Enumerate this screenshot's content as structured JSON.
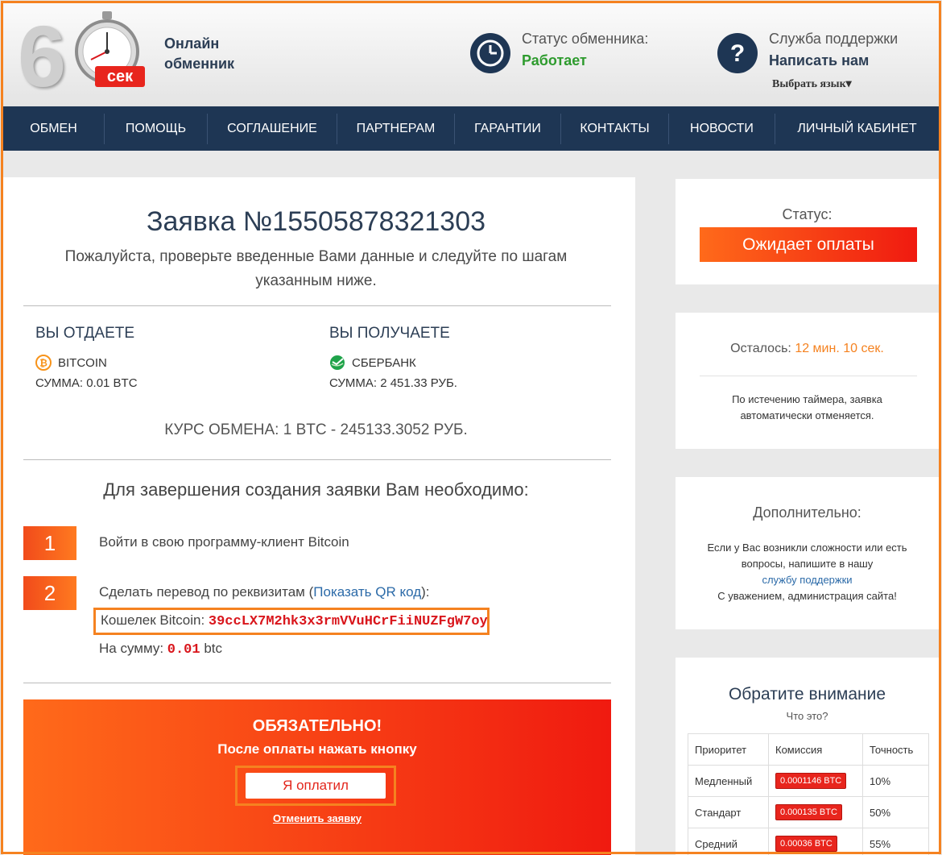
{
  "header": {
    "logo_number": "6",
    "logo_badge": "сек",
    "brand_line1": "Онлайн",
    "brand_line2": "обменник",
    "status_label": "Статус обменника:",
    "status_value": "Работает",
    "support_label": "Служба поддержки",
    "support_link": "Написать нам",
    "language_select": "Выбрать язык▾",
    "colors": {
      "status_ok": "#2e9b2e",
      "nav_bg": "#1e3654",
      "accent": "#f58220"
    }
  },
  "nav": {
    "items": [
      "ОБМЕН",
      "ПОМОЩЬ",
      "СОГЛАШЕНИЕ",
      "ПАРТНЕРАМ",
      "ГАРАНТИИ",
      "КОНТАКТЫ",
      "НОВОСТИ",
      "ЛИЧНЫЙ КАБИНЕТ"
    ]
  },
  "order": {
    "title": "Заявка №15505878321303",
    "subtitle": "Пожалуйста, проверьте введенные Вами данные и следуйте по шагам указанным ниже.",
    "give_heading": "ВЫ ОТДАЕТЕ",
    "give_currency": "BITCOIN",
    "give_sum": "СУММА: 0.01 BTC",
    "get_heading": "ВЫ ПОЛУЧАЕТЕ",
    "get_currency": "СБЕРБАНК",
    "get_sum": "СУММА: 2 451.33 РУБ.",
    "rate": "КУРС ОБМЕНА: 1 BTC - 245133.3052 РУБ.",
    "need_heading": "Для завершения создания заявки Вам необходимо:",
    "step1_num": "1",
    "step1_text": "Войти в свою программу-клиент Bitcoin",
    "step2_num": "2",
    "step2_text_before": "Сделать перевод по реквизитам (",
    "step2_qr_link": "Показать QR код",
    "step2_text_after": "):",
    "wallet_label": "Кошелек Bitcoin: ",
    "wallet_address": "39ccLX7M2hk3x3rmVVuHCrFiiNUZFgW7oy",
    "amount_label": "На сумму: ",
    "amount_value": "0.01",
    "amount_unit": " btc"
  },
  "cta": {
    "heading": "ОБЯЗАТЕЛЬНО!",
    "sub": "После оплаты нажать кнопку",
    "paid_button": "Я оплатил",
    "cancel_link": "Отменить заявку"
  },
  "sidebar": {
    "status_label": "Статус:",
    "status_value": "Ожидает оплаты",
    "remaining_label": "Осталось: ",
    "remaining_value": "12 мин. 10 сек.",
    "timer_note_line1": "По истечению таймера, заявка",
    "timer_note_line2": "автоматически отменяется.",
    "extra_heading": "Дополнительно:",
    "extra_line1": "Если у Вас возникли сложности или есть",
    "extra_line2": "вопросы, напишите в нашу",
    "extra_link": "службу поддержки",
    "extra_line3": "С уважением, администрация сайта!",
    "notice_heading": "Обратите внимание",
    "notice_link": "Что это?",
    "table_headers": [
      "Приоритет",
      "Комиссия",
      "Точность"
    ],
    "table_rows": [
      [
        "Медленный",
        "0.0001146 BTC",
        "10%"
      ],
      [
        "Стандарт",
        "0.000135 BTC",
        "50%"
      ],
      [
        "Средний",
        "0.00036 BTC",
        "55%"
      ]
    ]
  }
}
